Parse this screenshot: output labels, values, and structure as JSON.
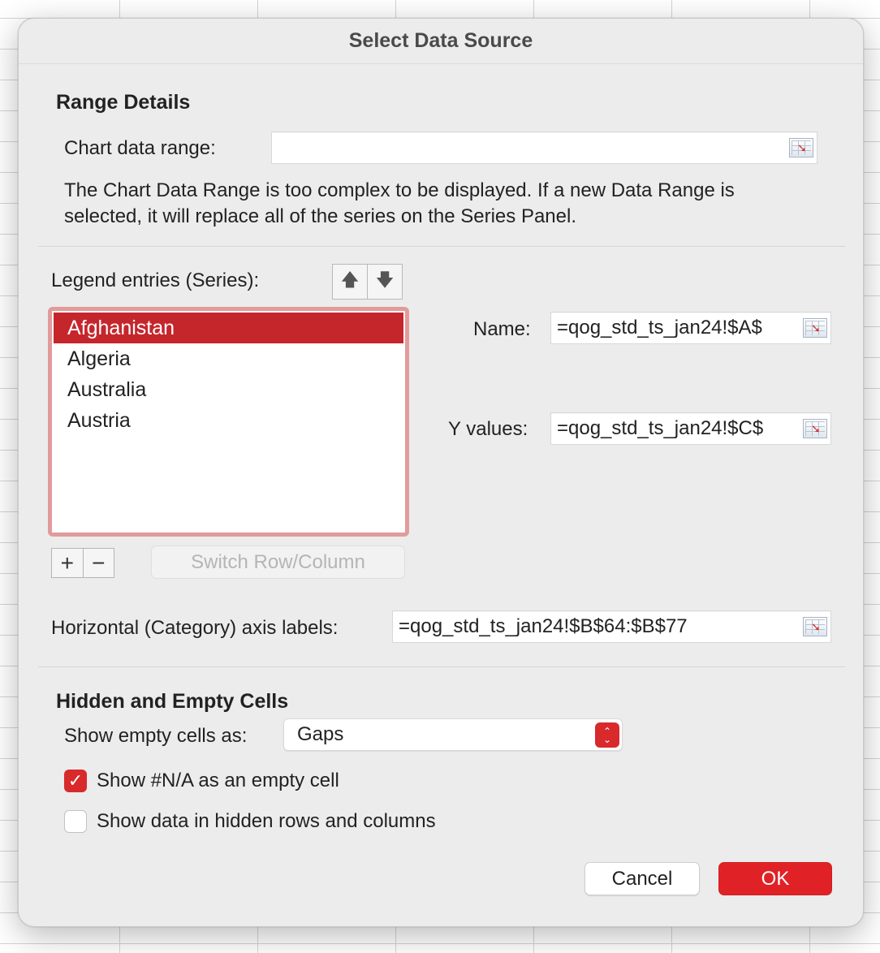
{
  "dialog": {
    "title": "Select Data Source"
  },
  "range_details": {
    "heading": "Range Details",
    "chart_data_range_label": "Chart data range:",
    "chart_data_range_value": "",
    "description": "The Chart Data Range is too complex to be displayed. If a new Data Range is selected, it will replace all of the series on the Series Panel."
  },
  "series": {
    "legend_label": "Legend entries (Series):",
    "move_up_icon": "arrow-up-icon",
    "move_down_icon": "arrow-down-icon",
    "items": [
      {
        "label": "Afghanistan",
        "selected": true
      },
      {
        "label": "Algeria",
        "selected": false
      },
      {
        "label": "Australia",
        "selected": false
      },
      {
        "label": "Austria",
        "selected": false
      }
    ],
    "add_symbol": "+",
    "remove_symbol": "−",
    "switch_label": "Switch Row/Column",
    "name_label": "Name:",
    "name_value": "=qog_std_ts_jan24!$A$",
    "y_values_label": "Y values:",
    "y_values_value": "=qog_std_ts_jan24!$C$"
  },
  "axis": {
    "label": "Horizontal (Category) axis labels:",
    "value": "=qog_std_ts_jan24!$B$64:$B$77"
  },
  "hidden_empty": {
    "heading": "Hidden and Empty Cells",
    "show_empty_label": "Show empty cells as:",
    "show_empty_value": "Gaps",
    "na_checkbox_label": "Show #N/A as an empty cell",
    "na_checked": true,
    "hidden_checkbox_label": "Show data in hidden rows and columns",
    "hidden_checked": false
  },
  "buttons": {
    "cancel": "Cancel",
    "ok": "OK"
  },
  "colors": {
    "accent": "#d8292b",
    "selection": "#c5262c",
    "list_focus_ring": "#e19b9b"
  }
}
